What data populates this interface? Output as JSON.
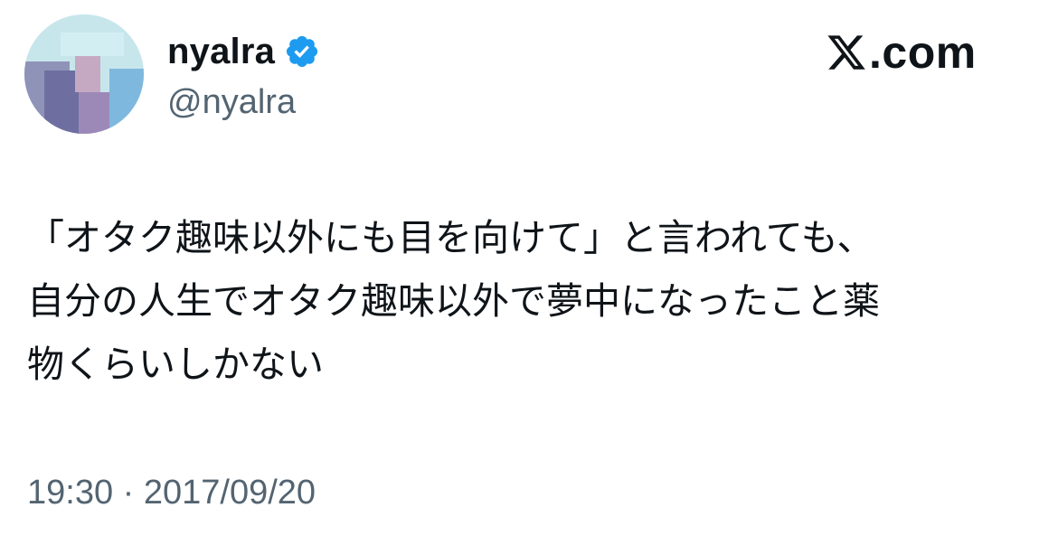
{
  "user": {
    "display_name": "nyalra",
    "handle": "@nyalra",
    "verified_icon": "verified-badge-icon",
    "avatar_icon": "avatar"
  },
  "brand": {
    "logo_icon": "x-logo-icon",
    "text": ".com"
  },
  "tweet": {
    "lines": [
      "「オタク趣味以外にも目を向けて」と言われても、",
      "自分の人生でオタク趣味以外で夢中になったこと薬",
      "物くらいしかない"
    ]
  },
  "meta": {
    "timestamp": "19:30 · 2017/09/20"
  },
  "colors": {
    "text": "#0f1419",
    "secondary": "#536471",
    "verified_blue": "#1d9bf0",
    "background": "#ffffff"
  }
}
